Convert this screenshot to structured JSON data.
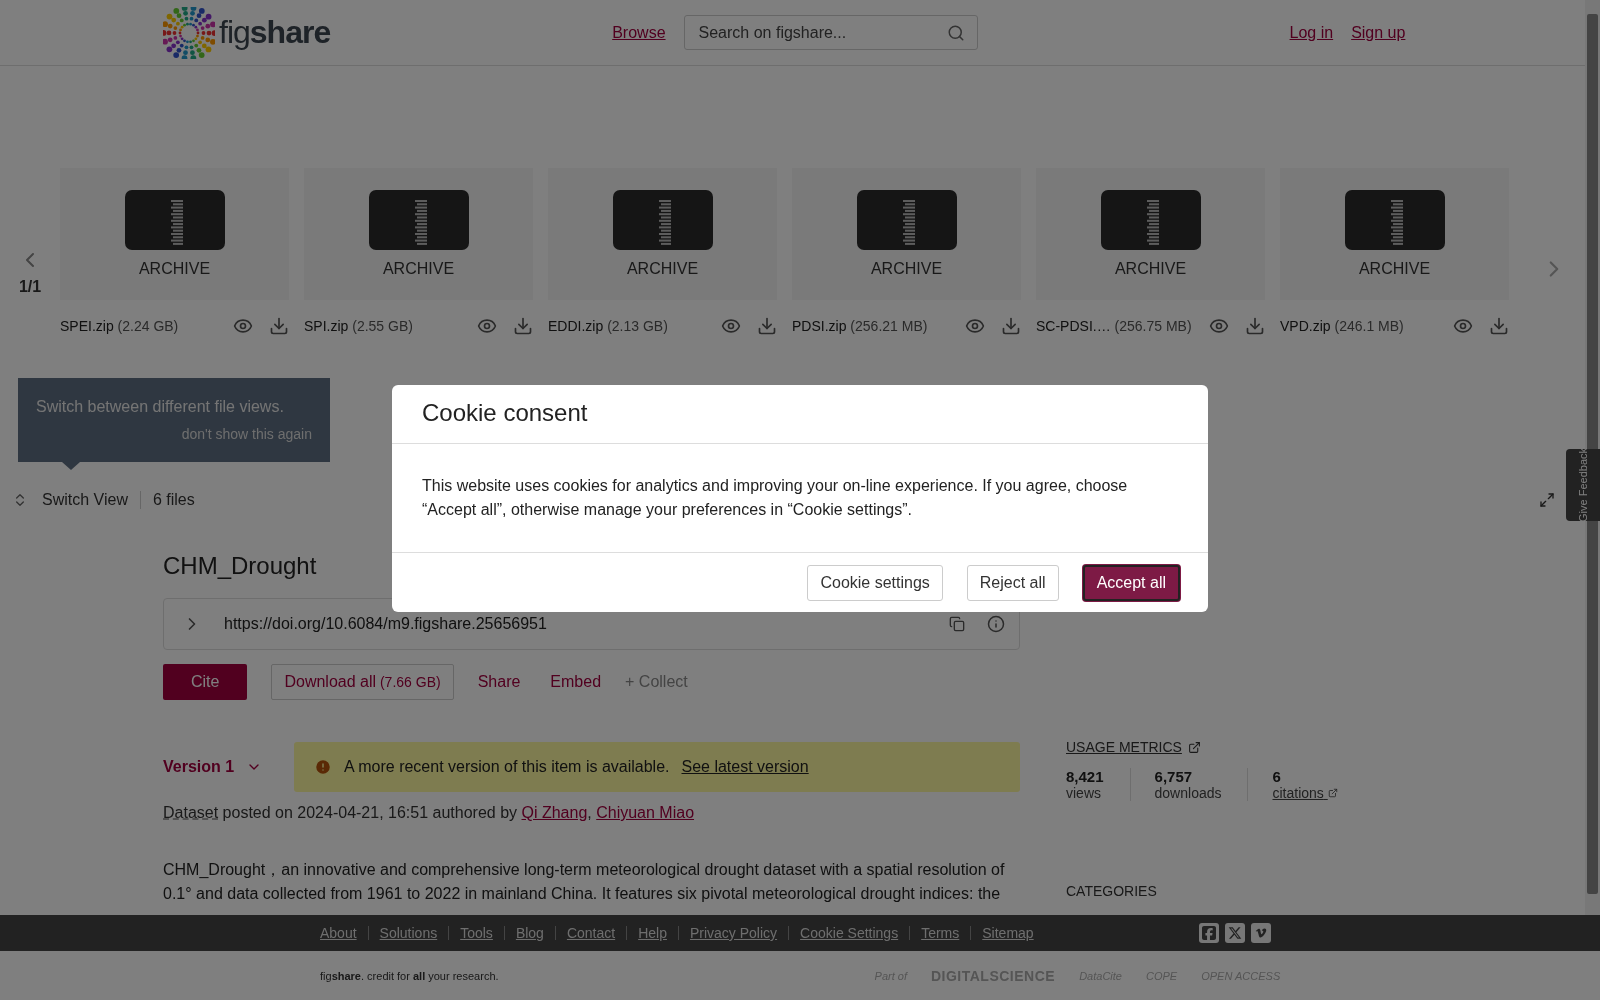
{
  "header": {
    "logo": "fig**share**",
    "nav_link": "Browse",
    "search": {
      "placeholder": "Search on figshare..."
    },
    "auth_links": [
      "Log in",
      "Sign up"
    ]
  },
  "carousel": {
    "pager": "1/1",
    "files": [
      {
        "type_label": "ARCHIVE",
        "name": "SPEI.zip",
        "size": "(2.24 GB)"
      },
      {
        "type_label": "ARCHIVE",
        "name": "SPI.zip",
        "size": "(2.55 GB)"
      },
      {
        "type_label": "ARCHIVE",
        "name": "EDDI.zip",
        "size": "(2.13 GB)"
      },
      {
        "type_label": "ARCHIVE",
        "name": "PDSI.zip",
        "size": "(256.21 MB)"
      },
      {
        "type_label": "ARCHIVE",
        "name": "SC-PDSI.…",
        "size": "(256.75 MB)"
      },
      {
        "type_label": "ARCHIVE",
        "name": "VPD.zip",
        "size": "(246.1 MB)"
      }
    ]
  },
  "hint": {
    "text": "Switch between different file views.",
    "dismiss": "don't show this again"
  },
  "file_bar": {
    "switch_view": "Switch View",
    "file_count": "6 files"
  },
  "item": {
    "title": "CHM_Drought",
    "doi": "https://doi.org/10.6084/m9.figshare.25656951",
    "actions": [
      {
        "kind": "primary",
        "label": "Cite"
      },
      {
        "kind": "outline",
        "label": "Download all",
        "extra": "(7.66 GB)"
      },
      {
        "kind": "link",
        "label": "Share"
      },
      {
        "kind": "link",
        "label": "Embed"
      },
      {
        "kind": "muted",
        "label": "+ Collect"
      }
    ],
    "version": "Version 1",
    "notice": {
      "text": "A more recent version of this item is available.",
      "link": "See latest version"
    },
    "posted": {
      "type": "Dataset",
      "text": "posted on 2024-04-21, 16:51 authored by",
      "authors": [
        "Qi Zhang",
        "Chiyuan Miao"
      ],
      "author_separator": ","
    },
    "description": "CHM_Drought，an innovative and comprehensive long-term meteorological drought dataset with a spatial resolution of 0.1° and data collected from 1961 to 2022 in mainland China. It features six pivotal meteorological drought indices: the"
  },
  "metrics": {
    "title": "USAGE METRICS",
    "items": [
      {
        "value": "8,421",
        "label": "views",
        "link": false
      },
      {
        "value": "6,757",
        "label": "downloads",
        "link": false
      },
      {
        "value": "6",
        "label": "citations",
        "link": true
      }
    ],
    "categories_title": "CATEGORIES"
  },
  "feedback": "Give Feedback",
  "footer": {
    "links": [
      "About",
      "Solutions",
      "Tools",
      "Blog",
      "Contact",
      "Help",
      "Privacy Policy",
      "Cookie Settings",
      "Terms",
      "Sitemap"
    ],
    "tagline": "fig**share**. credit for **all** your research.",
    "partners": [
      "Part of",
      "DIGITALSCIENCE",
      "DataCite",
      "COPE",
      "OPEN ACCESS"
    ]
  },
  "modal": {
    "title": "Cookie consent",
    "body": "This website uses cookies for analytics and improving your on-line experience. If you agree, choose “Accept all”, otherwise manage your preferences in “Cookie settings”.",
    "buttons": [
      {
        "kind": "secondary",
        "label": "Cookie settings"
      },
      {
        "kind": "secondary",
        "label": "Reject all"
      },
      {
        "kind": "primary",
        "label": "Accept all"
      }
    ]
  }
}
